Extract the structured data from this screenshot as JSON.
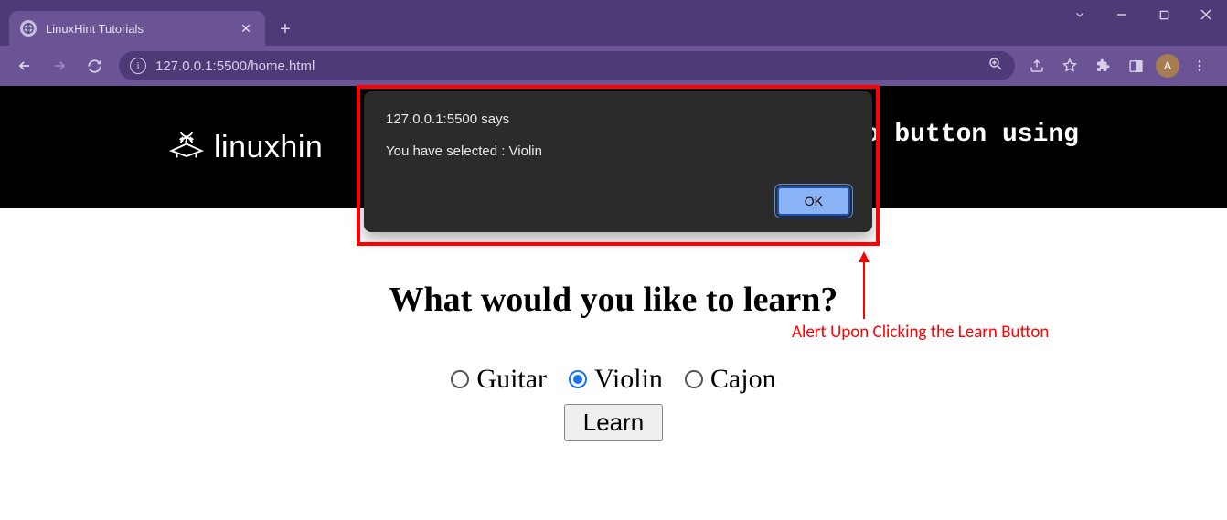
{
  "browser": {
    "tab_title": "LinuxHint Tutorials",
    "url": "127.0.0.1:5500/home.html",
    "profile_initial": "A"
  },
  "header": {
    "logo_text": "linuxhin",
    "right_text_fragment": "o button using"
  },
  "page": {
    "question": "What would you like to learn?",
    "options": [
      "Guitar",
      "Violin",
      "Cajon"
    ],
    "selected_index": 1,
    "learn_label": "Learn"
  },
  "alert": {
    "title": "127.0.0.1:5500 says",
    "message": "You have selected : Violin",
    "ok_label": "OK"
  },
  "annotation": {
    "text": "Alert Upon Clicking the Learn Button"
  }
}
